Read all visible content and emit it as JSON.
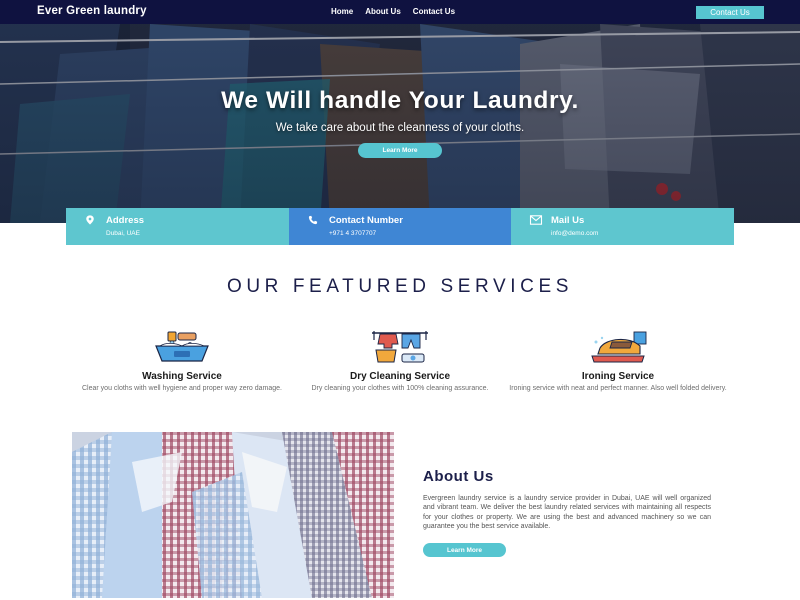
{
  "nav": {
    "brand": "Ever Green laundry",
    "links": [
      "Home",
      "About Us",
      "Contact Us"
    ],
    "cta": "Contact Us"
  },
  "hero": {
    "title": "We Will handle Your Laundry.",
    "subtitle": "We take care about the cleanness of your cloths.",
    "button": "Learn More"
  },
  "info": [
    {
      "title": "Address",
      "value": "Dubai, UAE",
      "icon": "map-marker-icon",
      "color": "#5ec6cf"
    },
    {
      "title": "Contact Number",
      "value": "+971 4 3707707",
      "icon": "phone-icon",
      "color": "#3f86d4"
    },
    {
      "title": "Mail Us",
      "value": "info@demo.com",
      "icon": "envelope-icon",
      "color": "#5ec6cf"
    }
  ],
  "services": {
    "heading": "OUR FEATURED SERVICES",
    "items": [
      {
        "title": "Washing Service",
        "desc": "Clear you cloths with well hygiene and proper way zero damage.",
        "icon": "washing-basin-icon"
      },
      {
        "title": "Dry Cleaning Service",
        "desc": "Dry cleaning your clothes with 100% cleaning assurance.",
        "icon": "clothesline-icon"
      },
      {
        "title": "Ironing Service",
        "desc": "Ironing service with neat and perfect manner. Also well folded delivery.",
        "icon": "iron-icon"
      }
    ]
  },
  "about": {
    "title": "About Us",
    "text": "Evergreen laundry service is a laundry service provider in Dubai, UAE will well organized and vibrant team. We deliver the best laundry related services with maintaining all respects for your clothes or property. We are using the best and advanced machinery so we can guarantee you the best service available.",
    "button": "Learn More"
  },
  "colors": {
    "nav_bg": "#0f1240",
    "accent": "#56c5d0",
    "info_blue": "#3f86d4",
    "heading": "#1c1f4a"
  }
}
